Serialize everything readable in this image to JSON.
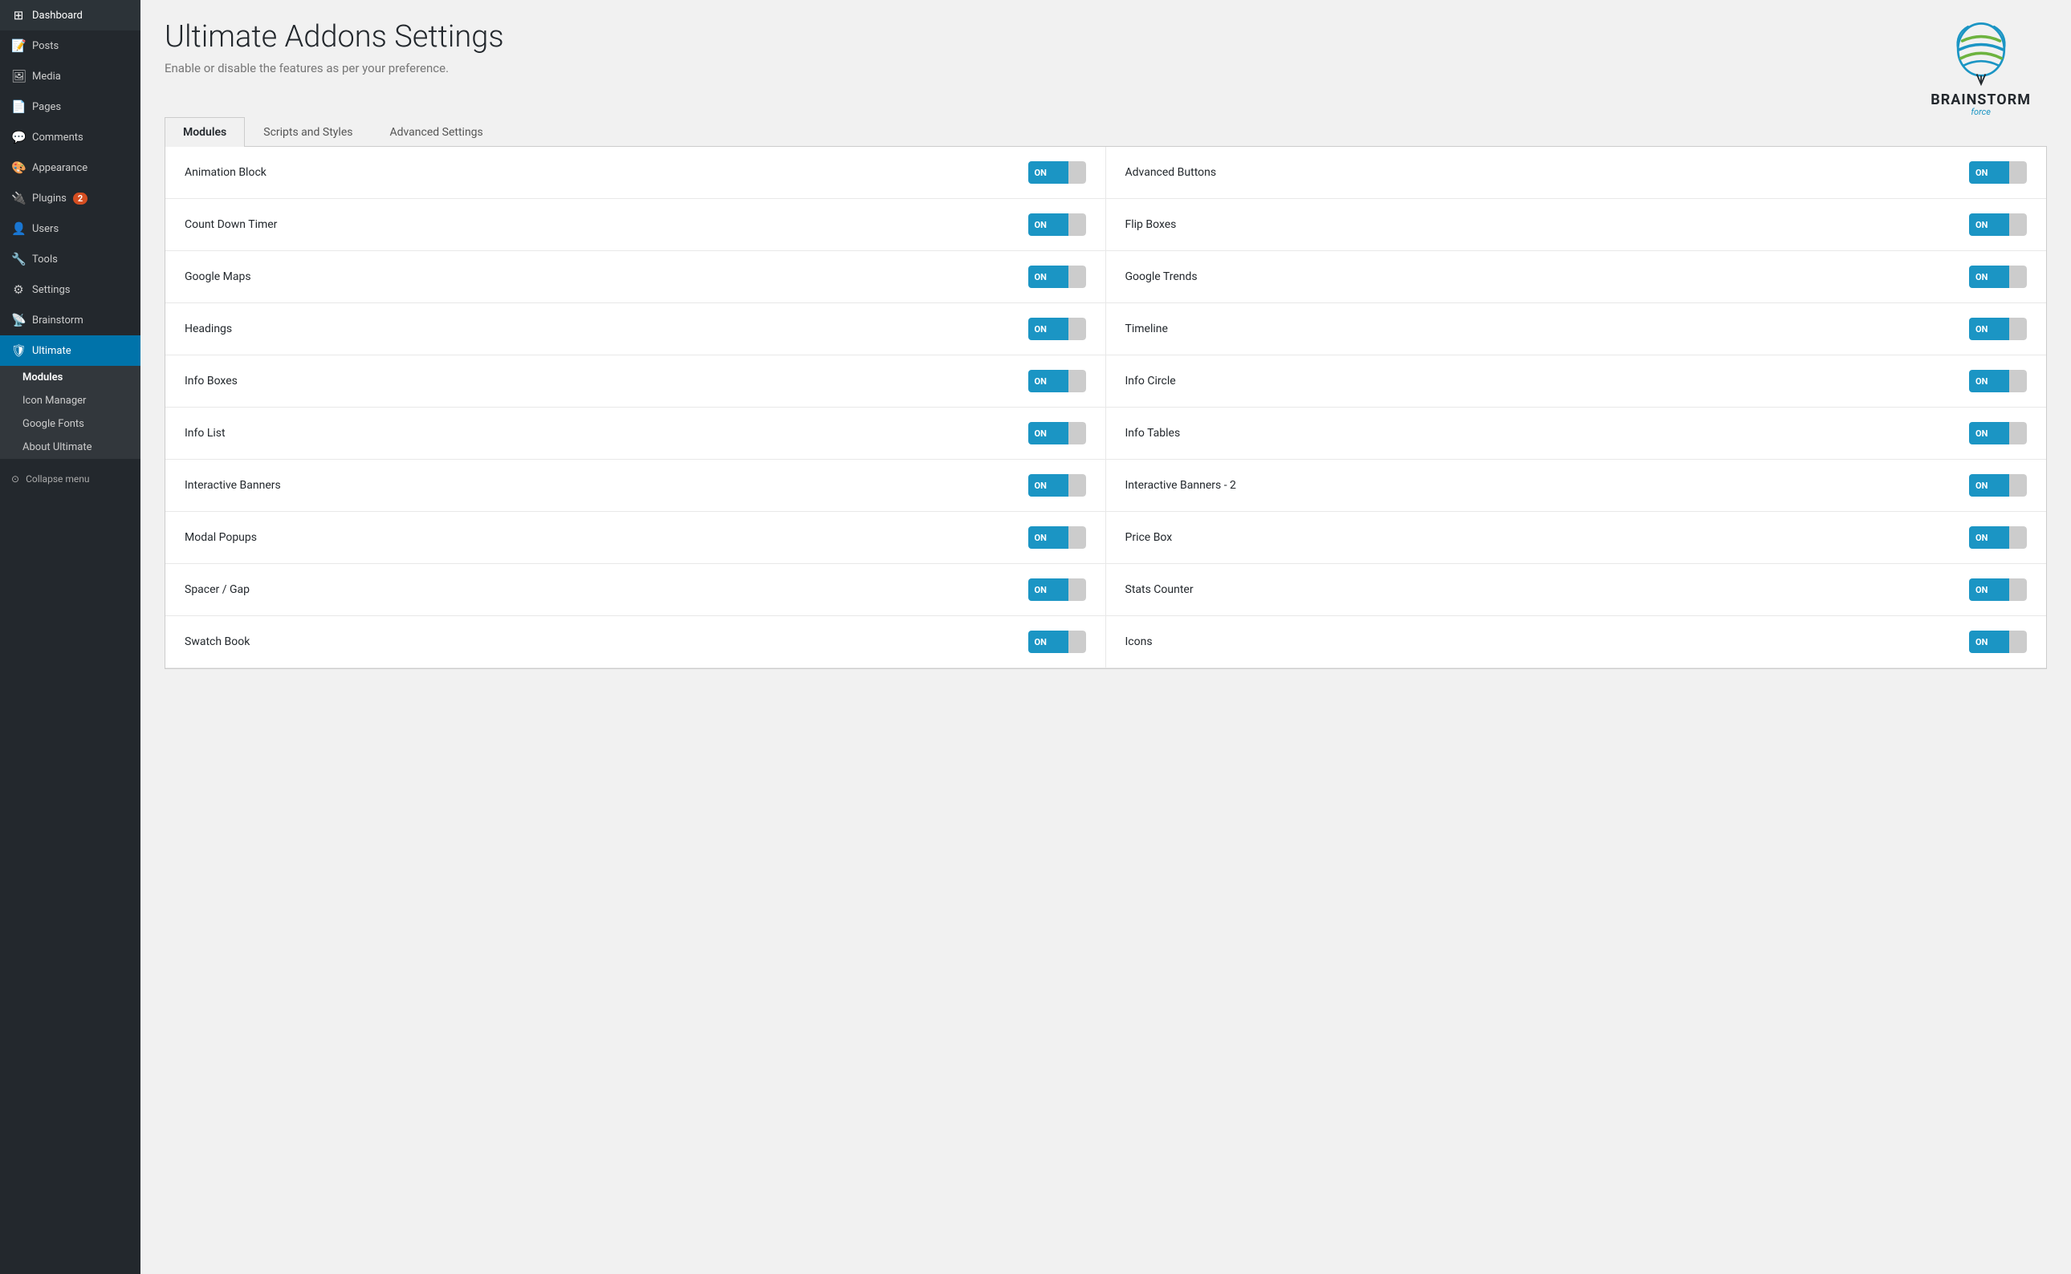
{
  "sidebar": {
    "items": [
      {
        "id": "dashboard",
        "label": "Dashboard",
        "icon": "⊞"
      },
      {
        "id": "posts",
        "label": "Posts",
        "icon": "📝"
      },
      {
        "id": "media",
        "label": "Media",
        "icon": "🖼"
      },
      {
        "id": "pages",
        "label": "Pages",
        "icon": "📄"
      },
      {
        "id": "comments",
        "label": "Comments",
        "icon": "💬"
      },
      {
        "id": "appearance",
        "label": "Appearance",
        "icon": "🎨"
      },
      {
        "id": "plugins",
        "label": "Plugins",
        "icon": "🔌",
        "badge": "2"
      },
      {
        "id": "users",
        "label": "Users",
        "icon": "👤"
      },
      {
        "id": "tools",
        "label": "Tools",
        "icon": "🔧"
      },
      {
        "id": "settings",
        "label": "Settings",
        "icon": "⚙"
      },
      {
        "id": "brainstorm",
        "label": "Brainstorm",
        "icon": "📡"
      },
      {
        "id": "ultimate",
        "label": "Ultimate",
        "icon": "🛡",
        "active": true
      }
    ],
    "submenu": [
      {
        "id": "modules",
        "label": "Modules",
        "active": true
      },
      {
        "id": "icon-manager",
        "label": "Icon Manager"
      },
      {
        "id": "google-fonts",
        "label": "Google Fonts"
      },
      {
        "id": "about-ultimate",
        "label": "About Ultimate"
      }
    ],
    "collapse_label": "Collapse menu"
  },
  "header": {
    "title": "Ultimate Addons Settings",
    "subtitle": "Enable or disable the features as per your preference."
  },
  "tabs": [
    {
      "id": "modules",
      "label": "Modules",
      "active": true
    },
    {
      "id": "scripts-and-styles",
      "label": "Scripts and Styles"
    },
    {
      "id": "advanced-settings",
      "label": "Advanced Settings"
    }
  ],
  "modules": [
    {
      "name": "Animation Block",
      "state": "ON",
      "col": 1
    },
    {
      "name": "Advanced Buttons",
      "state": "ON",
      "col": 2
    },
    {
      "name": "Count Down Timer",
      "state": "ON",
      "col": 1
    },
    {
      "name": "Flip Boxes",
      "state": "ON",
      "col": 2
    },
    {
      "name": "Google Maps",
      "state": "ON",
      "col": 1
    },
    {
      "name": "Google Trends",
      "state": "ON",
      "col": 2
    },
    {
      "name": "Headings",
      "state": "ON",
      "col": 1
    },
    {
      "name": "Timeline",
      "state": "ON",
      "col": 2
    },
    {
      "name": "Info Boxes",
      "state": "ON",
      "col": 1
    },
    {
      "name": "Info Circle",
      "state": "ON",
      "col": 2
    },
    {
      "name": "Info List",
      "state": "ON",
      "col": 1
    },
    {
      "name": "Info Tables",
      "state": "ON",
      "col": 2
    },
    {
      "name": "Interactive Banners",
      "state": "ON",
      "col": 1
    },
    {
      "name": "Interactive Banners - 2",
      "state": "ON",
      "col": 2
    },
    {
      "name": "Modal Popups",
      "state": "ON",
      "col": 1
    },
    {
      "name": "Price Box",
      "state": "ON",
      "col": 2
    },
    {
      "name": "Spacer / Gap",
      "state": "ON",
      "col": 1
    },
    {
      "name": "Stats Counter",
      "state": "ON",
      "col": 2
    },
    {
      "name": "Swatch Book",
      "state": "ON",
      "col": 1
    },
    {
      "name": "Icons",
      "state": "ON",
      "col": 2
    }
  ],
  "logo": {
    "text": "BRAINSTORM",
    "sub": "force"
  },
  "toggle": {
    "on_label": "ON"
  }
}
